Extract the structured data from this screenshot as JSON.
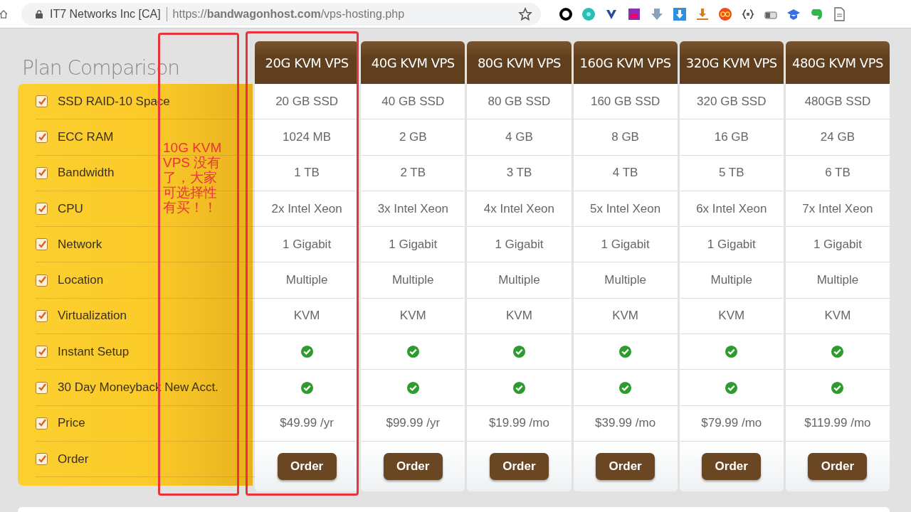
{
  "browser": {
    "site_identity": "IT7 Networks Inc [CA]",
    "url": "https://**bandwagonhost.com**/vps-hosting.php"
  },
  "title": "Plan Comparison",
  "features": [
    {
      "label": "SSD RAID-10 Space",
      "checked": true
    },
    {
      "label": "ECC RAM",
      "checked": true
    },
    {
      "label": "Bandwidth",
      "checked": true
    },
    {
      "label": "CPU",
      "checked": true
    },
    {
      "label": "Network",
      "checked": true
    },
    {
      "label": "Location",
      "checked": true
    },
    {
      "label": "Virtualization",
      "checked": true
    },
    {
      "label": "Instant Setup",
      "checked": true
    },
    {
      "label": "30 Day Moneyback New Acct.",
      "checked": true
    },
    {
      "label": "Price",
      "checked": true
    },
    {
      "label": "Order",
      "checked": true
    }
  ],
  "plans": [
    {
      "name": "20G KVM VPS",
      "specs": [
        "20 GB SSD",
        "1024 MB",
        "1 TB",
        "2x Intel Xeon",
        "1 Gigabit",
        "Multiple",
        "KVM"
      ],
      "instant_setup": true,
      "moneyback": true,
      "price": "$49.99 /yr",
      "order": "Order"
    },
    {
      "name": "40G KVM VPS",
      "specs": [
        "40 GB SSD",
        "2 GB",
        "2 TB",
        "3x Intel Xeon",
        "1 Gigabit",
        "Multiple",
        "KVM"
      ],
      "instant_setup": true,
      "moneyback": true,
      "price": "$99.99 /yr",
      "order": "Order"
    },
    {
      "name": "80G KVM VPS",
      "specs": [
        "80 GB SSD",
        "4 GB",
        "3 TB",
        "4x Intel Xeon",
        "1 Gigabit",
        "Multiple",
        "KVM"
      ],
      "instant_setup": true,
      "moneyback": true,
      "price": "$19.99 /mo",
      "order": "Order"
    },
    {
      "name": "160G KVM VPS",
      "specs": [
        "160 GB SSD",
        "8 GB",
        "4 TB",
        "5x Intel Xeon",
        "1 Gigabit",
        "Multiple",
        "KVM"
      ],
      "instant_setup": true,
      "moneyback": true,
      "price": "$39.99 /mo",
      "order": "Order"
    },
    {
      "name": "320G KVM VPS",
      "specs": [
        "320 GB SSD",
        "16 GB",
        "5 TB",
        "6x Intel Xeon",
        "1 Gigabit",
        "Multiple",
        "KVM"
      ],
      "instant_setup": true,
      "moneyback": true,
      "price": "$79.99 /mo",
      "order": "Order"
    },
    {
      "name": "480G KVM VPS",
      "specs": [
        "480GB SSD",
        "24 GB",
        "6 TB",
        "7x Intel Xeon",
        "1 Gigabit",
        "Multiple",
        "KVM"
      ],
      "instant_setup": true,
      "moneyback": true,
      "price": "$119.99 /mo",
      "order": "Order"
    }
  ],
  "annotation": {
    "text": "10G KVM VPS 没有了，大家可选择性有买！！"
  }
}
